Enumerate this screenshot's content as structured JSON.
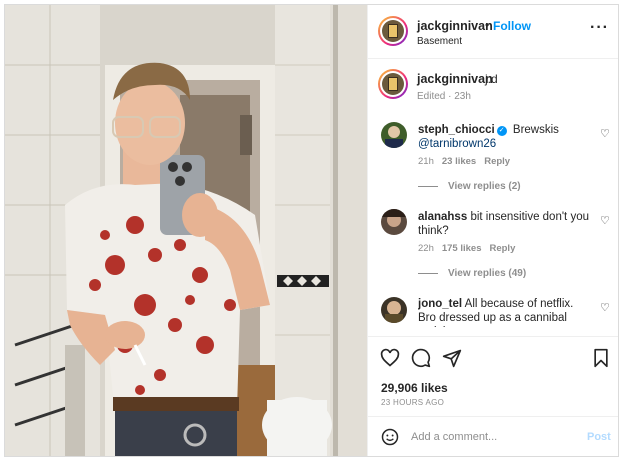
{
  "header": {
    "username": "jackginnivan",
    "dot": "•",
    "follow_label": "Follow",
    "location": "Basement",
    "more": "···"
  },
  "caption": {
    "username": "jackginnivan",
    "text": "j.d",
    "meta": "Edited · 23h"
  },
  "comments": [
    {
      "username": "steph_chiocci",
      "verified": true,
      "text": "Brewskis",
      "mention": "@tarnibrown26",
      "time": "21h",
      "likes": "23 likes",
      "reply": "Reply",
      "view_replies": "View replies (2)"
    },
    {
      "username": "alanahss",
      "text": "bit insensitive don't you think?",
      "time": "22h",
      "likes": "175 likes",
      "reply": "Reply",
      "view_replies": "View replies (49)"
    },
    {
      "username": "jono_tel",
      "text": "All because of netflix. Bro dressed up as a cannibal serial"
    }
  ],
  "actions": {
    "like_icon": "heart-icon",
    "comment_icon": "comment-icon",
    "share_icon": "share-icon",
    "save_icon": "bookmark-icon",
    "likes": "29,906 likes",
    "date": "23 HOURS AGO"
  },
  "add_comment": {
    "placeholder": "Add a comment...",
    "post_label": "Post"
  },
  "colors": {
    "accent": "#0095f6",
    "muted": "#8e8e8e",
    "post_disabled": "#b3dbff"
  }
}
